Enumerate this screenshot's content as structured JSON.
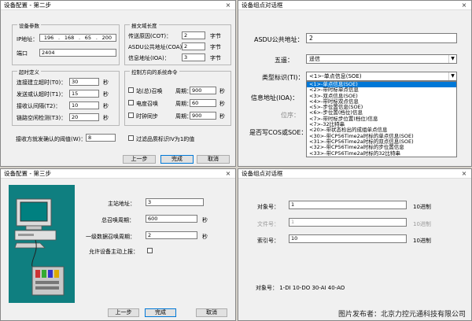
{
  "win1": {
    "title": "设备配置 - 第二步",
    "close": "×",
    "device_params": {
      "title": "设备参数",
      "ip_label": "IP地址：",
      "ip": [
        "196",
        "168",
        "65",
        "200"
      ],
      "port_label": "端口",
      "port": "2404"
    },
    "msg_length": {
      "title": "报文域长度",
      "cot_label": "传送原因(COT)：",
      "cot": "2",
      "cot_unit": "字节",
      "coa_label": "ASDU公共地址(COA)：",
      "coa": "2",
      "coa_unit": "字节",
      "ioa_label": "信息地址(IOA)：",
      "ioa": "3",
      "ioa_unit": "字节"
    },
    "timeouts": {
      "title": "超时定义",
      "t0_label": "连接建立超时(T0)：",
      "t0": "30",
      "t1_label": "发送或认超时(T1)：",
      "t1": "15",
      "t2_label": "接收认间隔(T2)：",
      "t2": "10",
      "t3_label": "链路空闲检测(T3)：",
      "t3": "20",
      "unit": "秒"
    },
    "commands": {
      "title": "控制方向的系统命令",
      "rows": [
        {
          "label": "站(总)召唤",
          "period_label": "周期：",
          "period": "900",
          "unit": "秒"
        },
        {
          "label": "电度召唤",
          "period_label": "周期：",
          "period": "60",
          "unit": "秒"
        },
        {
          "label": "时钟同步",
          "period_label": "周期：",
          "period": "900",
          "unit": "秒"
        }
      ]
    },
    "threshold_label": "接收方就发确认的阈值(W)：",
    "threshold": "8",
    "quality_label": "过滤品质标识IV为1的值",
    "buttons": {
      "prev": "上一步",
      "finish": "完成",
      "cancel": "取消"
    }
  },
  "win2": {
    "title": "设备组点对话框",
    "close": "×",
    "asdu_label": "ASDU公共地址：",
    "asdu": "2",
    "group_label": "五遥：",
    "group_value": "遥信",
    "type_label": "类型标识(TI)：",
    "type_value": "<1>-单点信息(SOE)",
    "ioa_label": "信息地址(IOA)：",
    "bit_label": "位序：",
    "cos_label": "是否写COS或SOE：",
    "type_options": [
      "<1>-单点信息(SOE)",
      "<2>-带时标单点信息",
      "<3>-双点信息(SOE)",
      "<4>-带时标双点信息",
      "<5>-步位置信息(SOE)",
      "<6>-步位置(档位)信息",
      "<7>-带时标步位置(档位)信息",
      "<7>-32比特串",
      "<20>-带状态检出的成组单点信息",
      "<30>-带CP56Time2a时标的单点信息(SOE)",
      "<31>-带CP56Time2a时标的双点信息(SOE)",
      "<32>-带CP56Time2a时标的步位置信息",
      "<33>-带CP56Time2a时标的32比特串"
    ],
    "selected_index": 0
  },
  "win3": {
    "title": "设备配置 - 第三步",
    "close": "×",
    "station_label": "主站地址：",
    "station": "3",
    "total_label": "总召唤周期：",
    "total": "600",
    "total_unit": "秒",
    "level1_label": "一级数据召唤周期：",
    "level1": "2",
    "level1_unit": "秒",
    "allow_label": "允许设备主动上报：",
    "buttons": {
      "prev": "上一步",
      "finish": "完成",
      "cancel": "取消"
    }
  },
  "win4": {
    "title": "设备组点对话框",
    "close": "×",
    "obj_label": "对象号：",
    "obj": "1",
    "obj_unit": "10进制",
    "file_label": "文件号：",
    "file": "1",
    "file_unit": "10进制",
    "idx_label": "索引号：",
    "idx": "10",
    "idx_unit": "10进制",
    "legend": "对象号： 1-DI   10-DO   30-AI   40-AO"
  },
  "footer": "图片发布者：北京力控元通科技有限公司",
  "colors": {
    "selection": "#0078d7",
    "window_bg": "#f0f0f0"
  }
}
